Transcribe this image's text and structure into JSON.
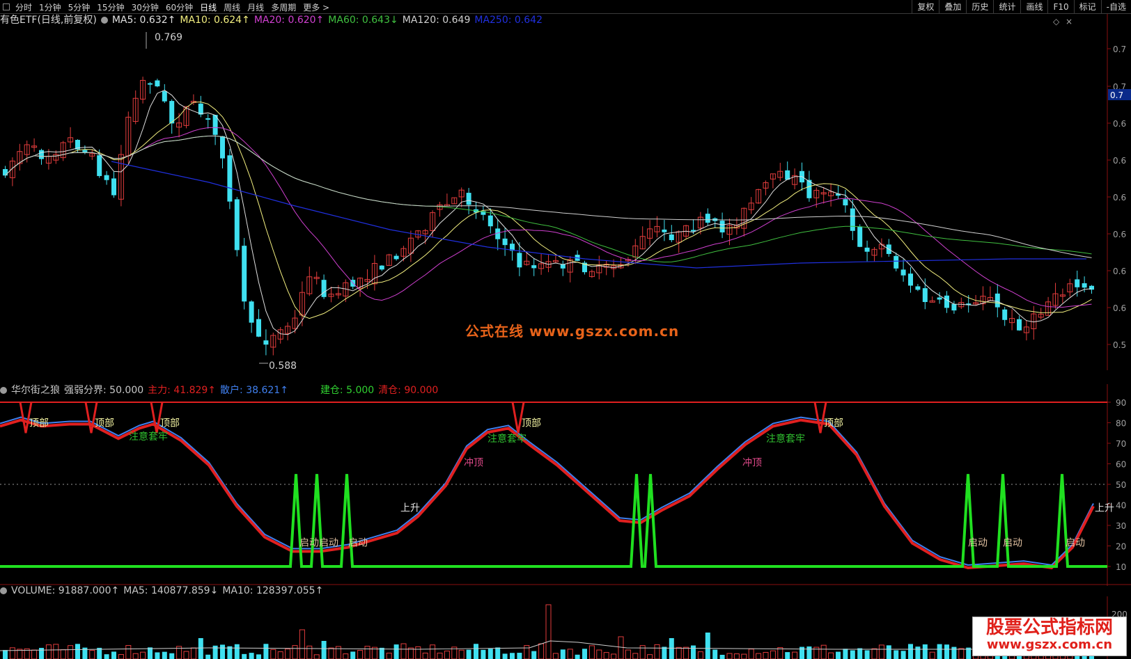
{
  "toolbar": {
    "periods": [
      "分时",
      "1分钟",
      "5分钟",
      "15分钟",
      "30分钟",
      "60分钟",
      "日线",
      "周线",
      "月线",
      "多周期",
      "更多 >"
    ],
    "active_period": "日线",
    "tools": [
      "复权",
      "叠加",
      "历史",
      "统计",
      "画线",
      "F10",
      "标记",
      "-自选"
    ]
  },
  "main": {
    "title": "有色ETF(日线,前复权)",
    "indicators": [
      {
        "label": "MA5: 0.632↑",
        "color": "#e0e0e0"
      },
      {
        "label": "MA10: 0.624↑",
        "color": "#f4f080"
      },
      {
        "label": "MA20: 0.620↑",
        "color": "#d040d0"
      },
      {
        "label": "MA60: 0.643↓",
        "color": "#40c040"
      },
      {
        "label": "MA120: 0.649",
        "color": "#d0d0d0"
      },
      {
        "label": "MA250: 0.642",
        "color": "#2030e0"
      }
    ],
    "high_label": "0.769",
    "low_label": "0.588",
    "price_tick_labels": [
      "0.7",
      "0.7",
      "0.6",
      "0.6",
      "0.6",
      "0.6",
      "0.6",
      "0.6",
      "0.5"
    ],
    "current_price_tag": "0.7"
  },
  "watermark": "公式在线  www.gszx.com.cn",
  "indicator_pane": {
    "name": "华尔街之狼",
    "parts": [
      {
        "label": "强弱分界: 50.000",
        "color": "#c8c8c8"
      },
      {
        "label": "主力: 41.829↑",
        "color": "#e02020"
      },
      {
        "label": "散户: 38.621↑",
        "color": "#4080f0"
      },
      {
        "label": "",
        "color": "#000"
      },
      {
        "label": "建仓: 5.000",
        "color": "#30d030"
      },
      {
        "label": "清仓: 90.000",
        "color": "#e02020"
      }
    ],
    "axis_labels": [
      "90",
      "80",
      "70",
      "60",
      "50",
      "40",
      "30",
      "20",
      "10"
    ],
    "annotations": {
      "top": "顶部",
      "caution": "注意套牢",
      "rush": "冲顶",
      "rise": "上升",
      "start": "启动"
    }
  },
  "volume_pane": {
    "parts": [
      {
        "label": "VOLUME: 91887.000↑",
        "color": "#c8c8c8"
      },
      {
        "label": "MA5: 140877.859↓",
        "color": "#c8c8c8"
      },
      {
        "label": "MA10: 128397.055↑",
        "color": "#c8c8c8"
      }
    ],
    "axis_label": "200"
  },
  "logo": {
    "title": "股票公式指标网",
    "url": "www.gszx.com.cn"
  },
  "colors": {
    "up": "#e23c3c",
    "down": "#3fe0f0",
    "main_line": "#e02020",
    "retail_line": "#4080f0",
    "signal_line": "#20e020"
  }
}
